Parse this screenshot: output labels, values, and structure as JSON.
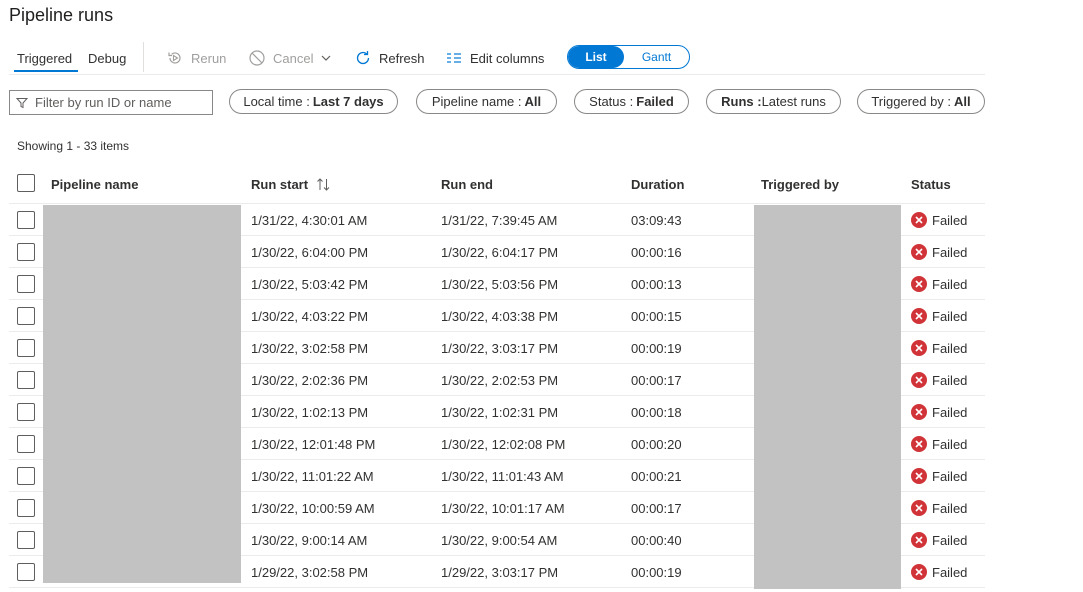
{
  "page": {
    "title": "Pipeline runs"
  },
  "tabs": {
    "triggered": "Triggered",
    "debug": "Debug"
  },
  "toolbar": {
    "rerun": "Rerun",
    "cancel": "Cancel",
    "refresh": "Refresh",
    "edit_columns": "Edit columns",
    "view_list": "List",
    "view_gantt": "Gantt"
  },
  "filters": {
    "search_placeholder": "Filter by run ID or name",
    "time": {
      "label": "Local time : ",
      "value": "Last 7 days"
    },
    "pipeline_name": {
      "label": "Pipeline name : ",
      "value": "All"
    },
    "status": {
      "label": "Status : ",
      "value": "Failed"
    },
    "runs": {
      "label": "Runs : ",
      "value": "Latest runs"
    },
    "triggered_by": {
      "label": "Triggered by : ",
      "value": "All"
    }
  },
  "showing": "Showing 1 - 33 items",
  "columns": {
    "pipeline_name": "Pipeline name",
    "run_start": "Run start",
    "run_end": "Run end",
    "duration": "Duration",
    "triggered_by": "Triggered by",
    "status": "Status"
  },
  "rows": [
    {
      "start": "1/31/22, 4:30:01 AM",
      "end": "1/31/22, 7:39:45 AM",
      "duration": "03:09:43",
      "status": "Failed"
    },
    {
      "start": "1/30/22, 6:04:00 PM",
      "end": "1/30/22, 6:04:17 PM",
      "duration": "00:00:16",
      "status": "Failed"
    },
    {
      "start": "1/30/22, 5:03:42 PM",
      "end": "1/30/22, 5:03:56 PM",
      "duration": "00:00:13",
      "status": "Failed"
    },
    {
      "start": "1/30/22, 4:03:22 PM",
      "end": "1/30/22, 4:03:38 PM",
      "duration": "00:00:15",
      "status": "Failed"
    },
    {
      "start": "1/30/22, 3:02:58 PM",
      "end": "1/30/22, 3:03:17 PM",
      "duration": "00:00:19",
      "status": "Failed"
    },
    {
      "start": "1/30/22, 2:02:36 PM",
      "end": "1/30/22, 2:02:53 PM",
      "duration": "00:00:17",
      "status": "Failed"
    },
    {
      "start": "1/30/22, 1:02:13 PM",
      "end": "1/30/22, 1:02:31 PM",
      "duration": "00:00:18",
      "status": "Failed"
    },
    {
      "start": "1/30/22, 12:01:48 PM",
      "end": "1/30/22, 12:02:08 PM",
      "duration": "00:00:20",
      "status": "Failed"
    },
    {
      "start": "1/30/22, 11:01:22 AM",
      "end": "1/30/22, 11:01:43 AM",
      "duration": "00:00:21",
      "status": "Failed"
    },
    {
      "start": "1/30/22, 10:00:59 AM",
      "end": "1/30/22, 10:01:17 AM",
      "duration": "00:00:17",
      "status": "Failed"
    },
    {
      "start": "1/30/22, 9:00:14 AM",
      "end": "1/30/22, 9:00:54 AM",
      "duration": "00:00:40",
      "status": "Failed"
    },
    {
      "start": "1/29/22, 3:02:58 PM",
      "end": "1/29/22, 3:03:17 PM",
      "duration": "00:00:19",
      "status": "Failed"
    }
  ],
  "colors": {
    "accent": "#0078d4",
    "failed": "#d13438",
    "redacted": "#c2c2c2"
  },
  "icons": {
    "rerun": "rerun-icon",
    "cancel": "cancel-icon",
    "refresh": "refresh-icon",
    "edit_columns": "columns-icon",
    "filter": "filter-icon",
    "sort": "sort-icon",
    "failed": "failed-status-icon"
  }
}
